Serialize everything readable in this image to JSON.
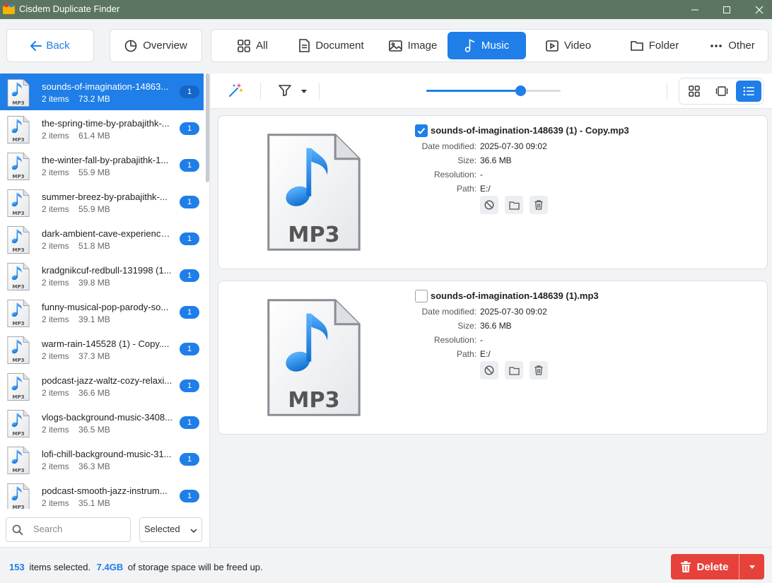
{
  "window": {
    "title": "Cisdem Duplicate Finder"
  },
  "nav": {
    "back_label": "Back",
    "overview_label": "Overview"
  },
  "categories": [
    {
      "label": "All",
      "icon": "grid-icon",
      "active": false
    },
    {
      "label": "Document",
      "icon": "document-icon",
      "active": false
    },
    {
      "label": "Image",
      "icon": "image-icon",
      "active": false
    },
    {
      "label": "Music",
      "icon": "music-icon",
      "active": true
    },
    {
      "label": "Video",
      "icon": "video-icon",
      "active": false
    },
    {
      "label": "Folder",
      "icon": "folder-icon",
      "active": false
    },
    {
      "label": "Other",
      "icon": "more-icon",
      "active": false
    }
  ],
  "groups": [
    {
      "name": "sounds-of-imagination-14863...",
      "meta": "2 items    73.2 MB",
      "badge": "1",
      "selected": true
    },
    {
      "name": "the-spring-time-by-prabajithk-...",
      "meta": "2 items    61.4 MB",
      "badge": "1"
    },
    {
      "name": "the-winter-fall-by-prabajithk-1...",
      "meta": "2 items    55.9 MB",
      "badge": "1"
    },
    {
      "name": "summer-breez-by-prabajithk-...",
      "meta": "2 items    55.9 MB",
      "badge": "1"
    },
    {
      "name": "dark-ambient-cave-experience...",
      "meta": "2 items    51.8 MB",
      "badge": "1"
    },
    {
      "name": "kradgnikcuf-redbull-131998 (1...",
      "meta": "2 items    39.8 MB",
      "badge": "1"
    },
    {
      "name": "funny-musical-pop-parody-so...",
      "meta": "2 items    39.1 MB",
      "badge": "1"
    },
    {
      "name": "warm-rain-145528 (1) - Copy....",
      "meta": "2 items    37.3 MB",
      "badge": "1"
    },
    {
      "name": "podcast-jazz-waltz-cozy-relaxi...",
      "meta": "2 items    36.6 MB",
      "badge": "1"
    },
    {
      "name": "vlogs-background-music-3408...",
      "meta": "2 items    36.5 MB",
      "badge": "1"
    },
    {
      "name": "lofi-chill-background-music-31...",
      "meta": "2 items    36.3 MB",
      "badge": "1"
    },
    {
      "name": "podcast-smooth-jazz-instrum...",
      "meta": "2 items    35.1 MB",
      "badge": "1"
    }
  ],
  "file_icon_text": "MP3",
  "search": {
    "placeholder": "Search"
  },
  "filter_select": {
    "value": "Selected"
  },
  "toolbar": {
    "zoom": 0.7
  },
  "labels": {
    "date": "Date modified:",
    "size": "Size:",
    "resolution": "Resolution:",
    "path": "Path:"
  },
  "files": [
    {
      "name": "sounds-of-imagination-148639 (1) - Copy.mp3",
      "date": "2025-07-30 09:02",
      "size": "36.6 MB",
      "resolution": "-",
      "path": "E:/",
      "checked": true
    },
    {
      "name": "sounds-of-imagination-148639 (1).mp3",
      "date": "2025-07-30 09:02",
      "size": "36.6 MB",
      "resolution": "-",
      "path": "E:/",
      "checked": false
    }
  ],
  "footer": {
    "count": "153",
    "count_suffix": "items selected.",
    "size": "7.4GB",
    "size_suffix": "of storage space will be freed up.",
    "delete_label": "Delete"
  },
  "colors": {
    "accent": "#1f7ee8",
    "delete": "#e6413a",
    "titlebar": "#5c7561"
  }
}
